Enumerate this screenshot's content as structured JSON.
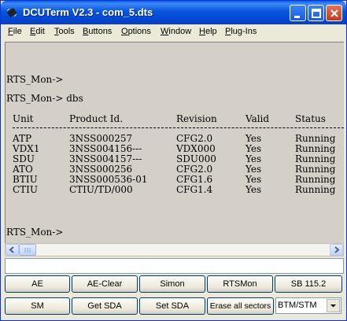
{
  "window": {
    "title": "DCUTerm V2.3 - com_5.dts"
  },
  "menu": [
    {
      "u": "F",
      "rest": "ile"
    },
    {
      "u": "E",
      "rest": "dit"
    },
    {
      "u": "T",
      "rest": "ools"
    },
    {
      "u": "B",
      "rest": "uttons"
    },
    {
      "u": "O",
      "rest": "ptions"
    },
    {
      "u": "W",
      "rest": "indow"
    },
    {
      "u": "H",
      "rest": "elp"
    },
    {
      "u": "P",
      "rest": "lug-Ins"
    }
  ],
  "terminal": {
    "prompt1": "RTS_Mon->",
    "prompt2": "RTS_Mon-> dbs",
    "prompt3": "RTS_Mon->",
    "headers": [
      "Unit",
      "Product Id.",
      "Revision",
      "Valid",
      "Status"
    ],
    "rows": [
      [
        "ATP",
        "3NSS000257",
        "CFG2.0",
        "Yes",
        "Running"
      ],
      [
        "VDX1",
        "3NSS004156---",
        "VDX000",
        "Yes",
        "Running"
      ],
      [
        "SDU",
        "3NSS004157---",
        "SDU000",
        "Yes",
        "Running"
      ],
      [
        "ATO",
        "3NSS000256",
        "CFG2.0",
        "Yes",
        "Running"
      ],
      [
        "BTIU",
        "3NSS000536-01",
        "CFG1.6",
        "Yes",
        "Running"
      ],
      [
        "CTIU",
        "CTIU/TD/000",
        "CFG1.4",
        "Yes",
        "Running"
      ]
    ]
  },
  "command_input": {
    "value": ""
  },
  "buttons_row1": [
    "AE",
    "AE-Clear",
    "Simon",
    "RTSMon",
    "SB 115.2"
  ],
  "buttons_row2": [
    "SM",
    "Get SDA",
    "Set SDA",
    "Erase all sectors"
  ],
  "mode_select": {
    "value": "BTM/STM"
  },
  "colors": {
    "titlebar": "#0855dd",
    "terminal_bg": "#d4d0c8",
    "window_bg": "#ece9d8"
  }
}
